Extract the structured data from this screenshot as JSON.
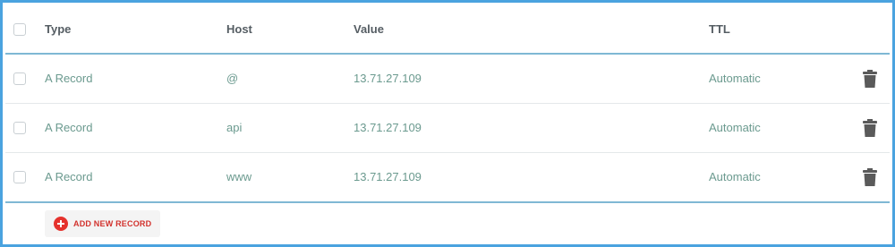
{
  "table": {
    "columns": {
      "type": "Type",
      "host": "Host",
      "value": "Value",
      "ttl": "TTL"
    },
    "rows": [
      {
        "type": "A Record",
        "host": "@",
        "value": "13.71.27.109",
        "ttl": "Automatic"
      },
      {
        "type": "A Record",
        "host": "api",
        "value": "13.71.27.109",
        "ttl": "Automatic"
      },
      {
        "type": "A Record",
        "host": "www",
        "value": "13.71.27.109",
        "ttl": "Automatic"
      }
    ]
  },
  "actions": {
    "add_label": "ADD NEW RECORD",
    "add_icon": "plus-circle-icon",
    "delete_icon": "trash-icon"
  },
  "colors": {
    "frame_border": "#4aa3df",
    "header_divider": "#7fb8d4",
    "row_text": "#6b9a8f",
    "add_accent": "#e5322d"
  }
}
